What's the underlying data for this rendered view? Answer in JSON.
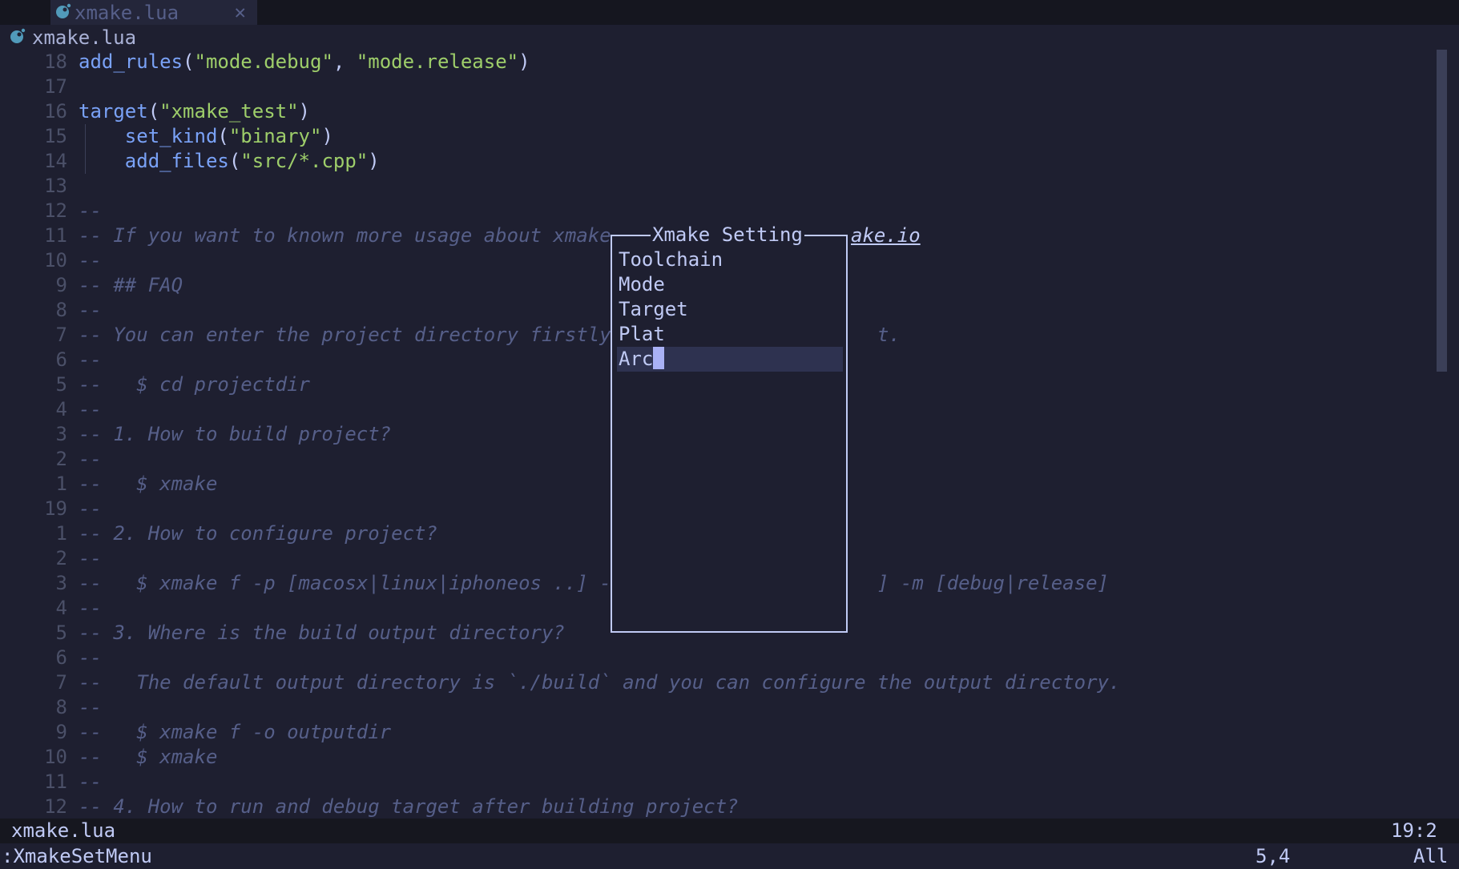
{
  "tabline": {
    "tab_label": "xmake.lua",
    "close_glyph": "✕"
  },
  "winbar": {
    "filename": "xmake.lua"
  },
  "lines": [
    {
      "ln": "18",
      "parts": [
        [
          "fn",
          "add_rules"
        ],
        [
          "pn",
          "("
        ],
        [
          "str",
          "\"mode.debug\""
        ],
        [
          "pn",
          ", "
        ],
        [
          "str",
          "\"mode.release\""
        ],
        [
          "pn",
          ")"
        ]
      ]
    },
    {
      "ln": "17",
      "parts": []
    },
    {
      "ln": "16",
      "parts": [
        [
          "fn",
          "target"
        ],
        [
          "pn",
          "("
        ],
        [
          "str",
          "\"xmake_test\""
        ],
        [
          "pn",
          ")"
        ]
      ]
    },
    {
      "ln": "15",
      "indent": true,
      "parts": [
        [
          "pn",
          "    "
        ],
        [
          "fn",
          "set_kind"
        ],
        [
          "pn",
          "("
        ],
        [
          "str",
          "\"binary\""
        ],
        [
          "pn",
          ")"
        ]
      ]
    },
    {
      "ln": "14",
      "indent": true,
      "parts": [
        [
          "pn",
          "    "
        ],
        [
          "fn",
          "add_files"
        ],
        [
          "pn",
          "("
        ],
        [
          "str",
          "\"src/*.cpp\""
        ],
        [
          "pn",
          ")"
        ]
      ]
    },
    {
      "ln": "13",
      "parts": []
    },
    {
      "ln": "12",
      "parts": [
        [
          "cm",
          "--"
        ]
      ]
    },
    {
      "ln": "11",
      "parts": [
        [
          "cm",
          "-- If you want to known more usage about xmake, "
        ]
      ],
      "tail": "ake.io"
    },
    {
      "ln": "10",
      "parts": [
        [
          "cm",
          "--"
        ]
      ]
    },
    {
      "ln": "9",
      "parts": [
        [
          "cm",
          "-- ## FAQ"
        ]
      ]
    },
    {
      "ln": "8",
      "parts": [
        [
          "cm",
          "--"
        ]
      ]
    },
    {
      "ln": "7",
      "parts": [
        [
          "cm",
          "-- You can enter the project directory firstly                       t."
        ]
      ]
    },
    {
      "ln": "6",
      "parts": [
        [
          "cm",
          "--"
        ]
      ]
    },
    {
      "ln": "5",
      "parts": [
        [
          "cm",
          "--   $ cd projectdir"
        ]
      ]
    },
    {
      "ln": "4",
      "parts": [
        [
          "cm",
          "--"
        ]
      ]
    },
    {
      "ln": "3",
      "parts": [
        [
          "cm",
          "-- 1. How to build project?"
        ]
      ]
    },
    {
      "ln": "2",
      "parts": [
        [
          "cm",
          "--"
        ]
      ]
    },
    {
      "ln": "1",
      "parts": [
        [
          "cm",
          "--   $ xmake"
        ]
      ]
    },
    {
      "ln": "19",
      "parts": [
        [
          "cm",
          "--"
        ]
      ]
    },
    {
      "ln": "1",
      "parts": [
        [
          "cm",
          "-- 2. How to configure project?"
        ]
      ]
    },
    {
      "ln": "2",
      "parts": [
        [
          "cm",
          "--"
        ]
      ]
    },
    {
      "ln": "3",
      "parts": [
        [
          "cm",
          "--   $ xmake f -p [macosx|linux|iphoneos ..] -a                      ] -m [debug|release]"
        ]
      ]
    },
    {
      "ln": "4",
      "parts": [
        [
          "cm",
          "--"
        ]
      ]
    },
    {
      "ln": "5",
      "parts": [
        [
          "cm",
          "-- 3. Where is the build output directory?"
        ]
      ]
    },
    {
      "ln": "6",
      "parts": [
        [
          "cm",
          "--"
        ]
      ]
    },
    {
      "ln": "7",
      "parts": [
        [
          "cm",
          "--   The default output directory is `./build` and you can configure the output directory."
        ]
      ]
    },
    {
      "ln": "8",
      "parts": [
        [
          "cm",
          "--"
        ]
      ]
    },
    {
      "ln": "9",
      "parts": [
        [
          "cm",
          "--   $ xmake f -o outputdir"
        ]
      ]
    },
    {
      "ln": "10",
      "parts": [
        [
          "cm",
          "--   $ xmake"
        ]
      ]
    },
    {
      "ln": "11",
      "parts": [
        [
          "cm",
          "--"
        ]
      ]
    },
    {
      "ln": "12",
      "parts": [
        [
          "cm",
          "-- 4. How to run and debug target after building project?"
        ]
      ]
    }
  ],
  "menu": {
    "title": "Xmake Setting",
    "items": [
      "Toolchain",
      "Mode",
      "Target",
      "Plat",
      "Arc"
    ],
    "selected_index": 4
  },
  "statusline": {
    "filename": "xmake.lua",
    "position": "19:2"
  },
  "cmdline": {
    "command": ":XmakeSetMenu",
    "ruler": "5,4",
    "scroll": "All"
  },
  "colors": {
    "function": "#7aa2f7",
    "string": "#9ece6a",
    "comment": "#565f89",
    "background": "#1e1f30",
    "file_icon": "#519aba"
  }
}
